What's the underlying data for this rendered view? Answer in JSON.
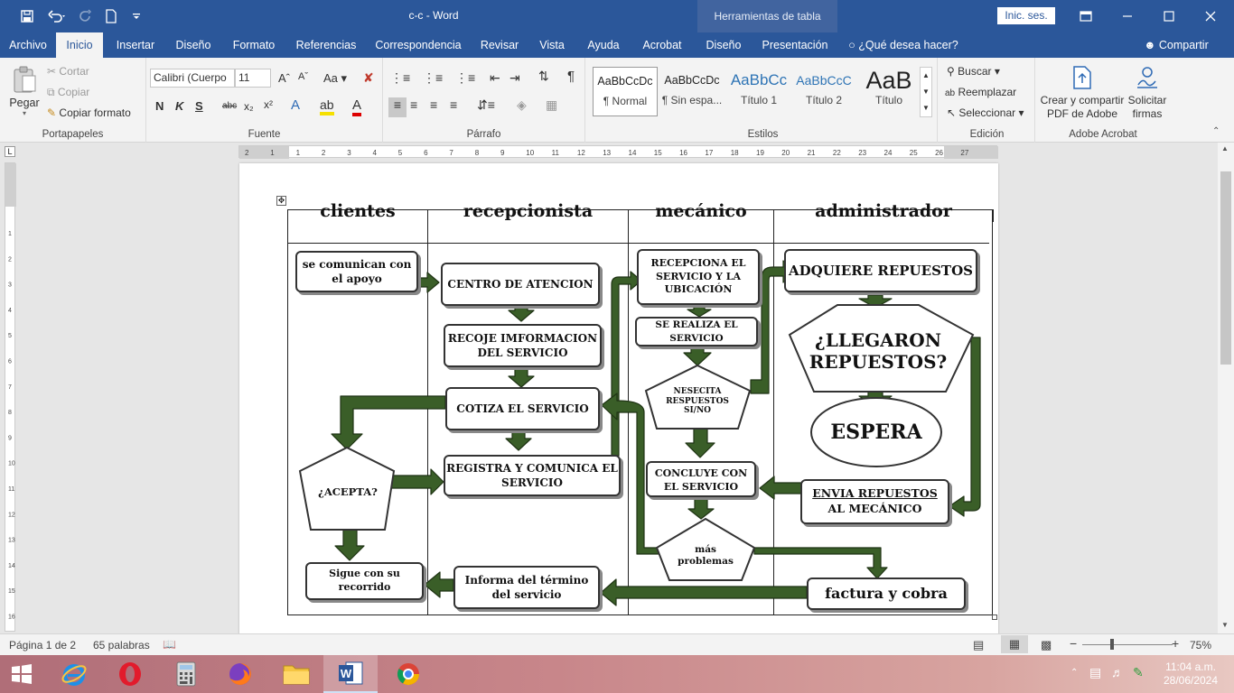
{
  "titlebar": {
    "document": "c-c",
    "app": "Word",
    "title": "c-c  -  Word",
    "context_tab": "Herramientas de tabla",
    "signin": "Inic. ses."
  },
  "menu": {
    "tabs": [
      "Archivo",
      "Inicio",
      "Insertar",
      "Diseño",
      "Formato",
      "Referencias",
      "Correspondencia",
      "Revisar",
      "Vista",
      "Ayuda",
      "Acrobat",
      "Diseño",
      "Presentación"
    ],
    "active": "Inicio",
    "tellme": "¿Qué desea hacer?",
    "share": "Compartir"
  },
  "ribbon": {
    "clipboard": {
      "label": "Portapapeles",
      "paste": "Pegar",
      "cut": "Cortar",
      "copy": "Copiar",
      "format_painter": "Copiar formato"
    },
    "font": {
      "label": "Fuente",
      "name": "Calibri (Cuerpo",
      "size": "11",
      "bold": "N",
      "italic": "K",
      "underline": "S",
      "strike": "abc",
      "sub": "x₂",
      "sup": "x²",
      "case": "Aa"
    },
    "paragraph": {
      "label": "Párrafo"
    },
    "styles": {
      "label": "Estilos",
      "items": [
        {
          "preview": "AaBbCcDc",
          "name": "¶ Normal"
        },
        {
          "preview": "AaBbCcDc",
          "name": "¶ Sin espa..."
        },
        {
          "preview": "AaBbCc",
          "name": "Título 1"
        },
        {
          "preview": "AaBbCcC",
          "name": "Título 2"
        },
        {
          "preview": "AaB",
          "name": "Título"
        }
      ]
    },
    "editing": {
      "label": "Edición",
      "find": "Buscar",
      "replace": "Reemplazar",
      "select": "Seleccionar"
    },
    "acrobat": {
      "label": "Adobe Acrobat",
      "create_share": "Crear y compartir",
      "create_share2": "PDF de Adobe",
      "request": "Solicitar",
      "request2": "firmas"
    }
  },
  "rulers": {
    "h_ticks": [
      "2",
      "1",
      "1",
      "2",
      "3",
      "4",
      "5",
      "6",
      "7",
      "8",
      "9",
      "10",
      "11",
      "12",
      "13",
      "14",
      "15",
      "16",
      "17",
      "18",
      "19",
      "20",
      "21",
      "22",
      "23",
      "24",
      "25",
      "26",
      "27"
    ],
    "v_ticks": [
      "1",
      "2",
      "3",
      "4",
      "5",
      "6",
      "7",
      "8",
      "9",
      "10",
      "11",
      "12",
      "13",
      "14",
      "15",
      "16"
    ]
  },
  "diagram": {
    "headers": [
      "clientes",
      "recepcionista",
      "mecánico",
      "administrador"
    ],
    "boxes": {
      "comunican": "se comunican con el apoyo",
      "centro": "CENTRO DE ATENCION",
      "recoje": "RECOJE IMFORMACION DEL SERVICIO",
      "cotiza": "COTIZA EL SERVICIO",
      "registra": "REGISTRA Y COMUNICA EL SERVICIO",
      "informa": "Informa del término del servicio",
      "sigue": "Sigue con su recorrido",
      "recepciona": "RECEPCIONA EL SERVICIO Y LA UBICACIÓN",
      "realiza": "SE REALIZA EL SERVICIO",
      "concluye": "CONCLUYE CON EL SERVICIO",
      "adquiere": "ADQUIERE REPUESTOS",
      "envia_a": "ENVIA  REPUESTOS",
      "envia_b": " AL MECÁNICO",
      "factura": "factura y cobra"
    },
    "shapes": {
      "acepta": "¿ACEPTA?",
      "necesita": "NESECITA RESPUESTOS SI/NO",
      "problemas": "más problemas",
      "llegaron": "¿LLEGARON REPUESTOS?",
      "espera": "ESPERA"
    }
  },
  "status": {
    "page": "Página 1 de 2",
    "words": "65 palabras",
    "zoom": "75%"
  },
  "taskbar": {
    "time": "11:04 a.m.",
    "date": "28/06/2024"
  },
  "colors": {
    "word_blue": "#2b579a",
    "arrow_green": "#3a5e28",
    "arrow_edge": "#1f3314"
  }
}
